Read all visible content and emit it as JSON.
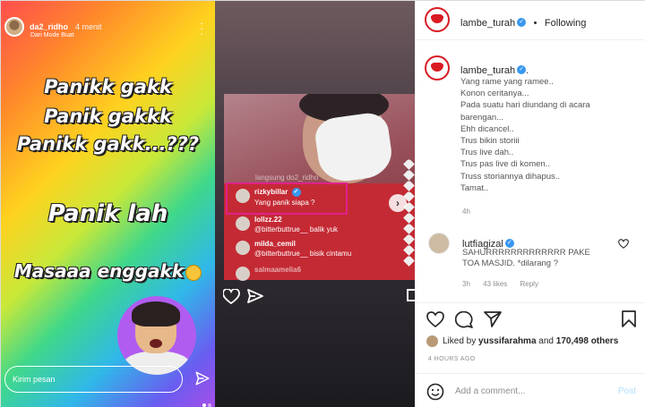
{
  "story": {
    "username": "da2_ridho",
    "time": "4 menit",
    "subtitle": "Dari Mode Buat",
    "more_icon": "more-vertical-icon",
    "lines": [
      "Panikk gakk",
      "Panik gakkk",
      "Panikk gakk...???",
      "Panik lah",
      "Masaaa enggakk"
    ],
    "message_placeholder": "Kirim pesan",
    "send_icon": "send-icon"
  },
  "video": {
    "faded_text": "langsung do2_ridho",
    "comments": [
      {
        "user": "rizkybillar",
        "text": "Yang panik siapa ?"
      },
      {
        "user": "lollzz.22",
        "text": "@bitterbuttrue__ balik yuk"
      },
      {
        "user": "milda_cemil",
        "text": "@bitterbuttrue__ bisik cintamu"
      },
      {
        "user": "salmaamelia6",
        "text": ""
      }
    ],
    "highlight_color": "#e0218a",
    "next_icon": "chevron-right-icon"
  },
  "post": {
    "author": "lambe_turah",
    "follow_sep": "•",
    "follow_label": "Following",
    "caption_suffix": ".",
    "caption_lines": [
      "Yang rame yang ramee..",
      "Konon ceritanya...",
      "Pada suatu hari diundang di acara",
      "barengan...",
      "Ehh dicancel..",
      "Trus bikin storiii",
      "Trus live dah..",
      "Trus pas live di komen..",
      "Truss storiannya dihapus..",
      "Tamat.."
    ],
    "caption_time": "4h",
    "comment": {
      "user": "lutfiagizal",
      "text": "SAHURRRRRRRRRRRRR PAKE TOA MASJID. *dilarang ?",
      "time": "3h",
      "likes": "43 likes",
      "reply": "Reply"
    },
    "liked_prefix": "Liked by",
    "liked_user": "yussifarahma",
    "liked_and": "and",
    "liked_count": "170,498 others",
    "post_time": "4 HOURS AGO",
    "add_comment_placeholder": "Add a comment...",
    "post_button": "Post",
    "accent": "#3897f0",
    "brand_red": "#d81b23"
  }
}
